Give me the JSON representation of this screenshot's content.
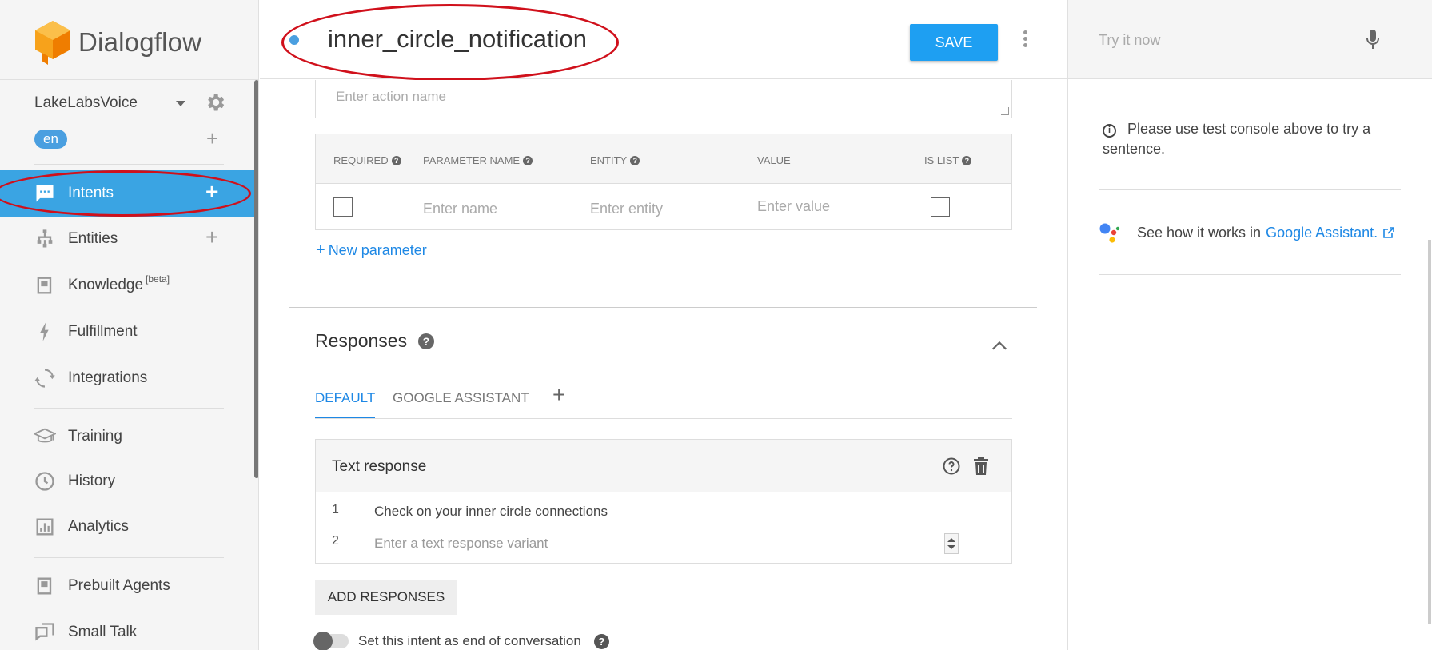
{
  "app": {
    "name": "Dialogflow"
  },
  "sidebar": {
    "agent_name": "LakeLabsVoice",
    "language": "en",
    "items": [
      {
        "label": "Intents",
        "icon": "chat-bubble-icon",
        "has_add": true,
        "active": true
      },
      {
        "label": "Entities",
        "icon": "hierarchy-icon",
        "has_add": true,
        "active": false
      },
      {
        "label": "Knowledge",
        "badge": "[beta]",
        "icon": "book-icon",
        "active": false
      },
      {
        "label": "Fulfillment",
        "icon": "bolt-icon",
        "active": false
      },
      {
        "label": "Integrations",
        "icon": "sync-icon",
        "active": false
      },
      {
        "label": "Training",
        "icon": "graduation-cap-icon",
        "active": false
      },
      {
        "label": "History",
        "icon": "clock-icon",
        "active": false
      },
      {
        "label": "Analytics",
        "icon": "bar-chart-icon",
        "active": false
      },
      {
        "label": "Prebuilt Agents",
        "icon": "agent-book-icon",
        "active": false
      },
      {
        "label": "Small Talk",
        "icon": "chat-squares-icon",
        "active": false
      }
    ]
  },
  "header": {
    "intent_name": "inner_circle_notification",
    "save_label": "SAVE"
  },
  "action": {
    "placeholder": "Enter action name"
  },
  "parameters": {
    "columns": [
      "REQUIRED",
      "PARAMETER NAME",
      "ENTITY",
      "VALUE",
      "IS LIST"
    ],
    "row": {
      "name_placeholder": "Enter name",
      "entity_placeholder": "Enter entity",
      "value_placeholder": "Enter value"
    },
    "new_parameter_label": "New parameter"
  },
  "responses": {
    "title": "Responses",
    "tabs": [
      "DEFAULT",
      "GOOGLE ASSISTANT"
    ],
    "active_tab": "DEFAULT",
    "text_response": {
      "title": "Text response",
      "lines": [
        {
          "num": "1",
          "text": "Check on your inner circle connections"
        },
        {
          "num": "2",
          "placeholder": "Enter a text response variant"
        }
      ]
    },
    "add_label": "ADD RESPONSES",
    "end_of_conversation_label": "Set this intent as end of conversation"
  },
  "right_panel": {
    "try_placeholder": "Try it now",
    "info_text": "Please use test console above to try a sentence.",
    "ga_prefix": "See how it works in",
    "ga_link": "Google Assistant."
  },
  "colors": {
    "accent": "#3aa4e3",
    "save_button": "#1e9ff2",
    "link": "#1e88e5",
    "annotation": "#d0101b",
    "logo_orange": "#f57c00"
  }
}
